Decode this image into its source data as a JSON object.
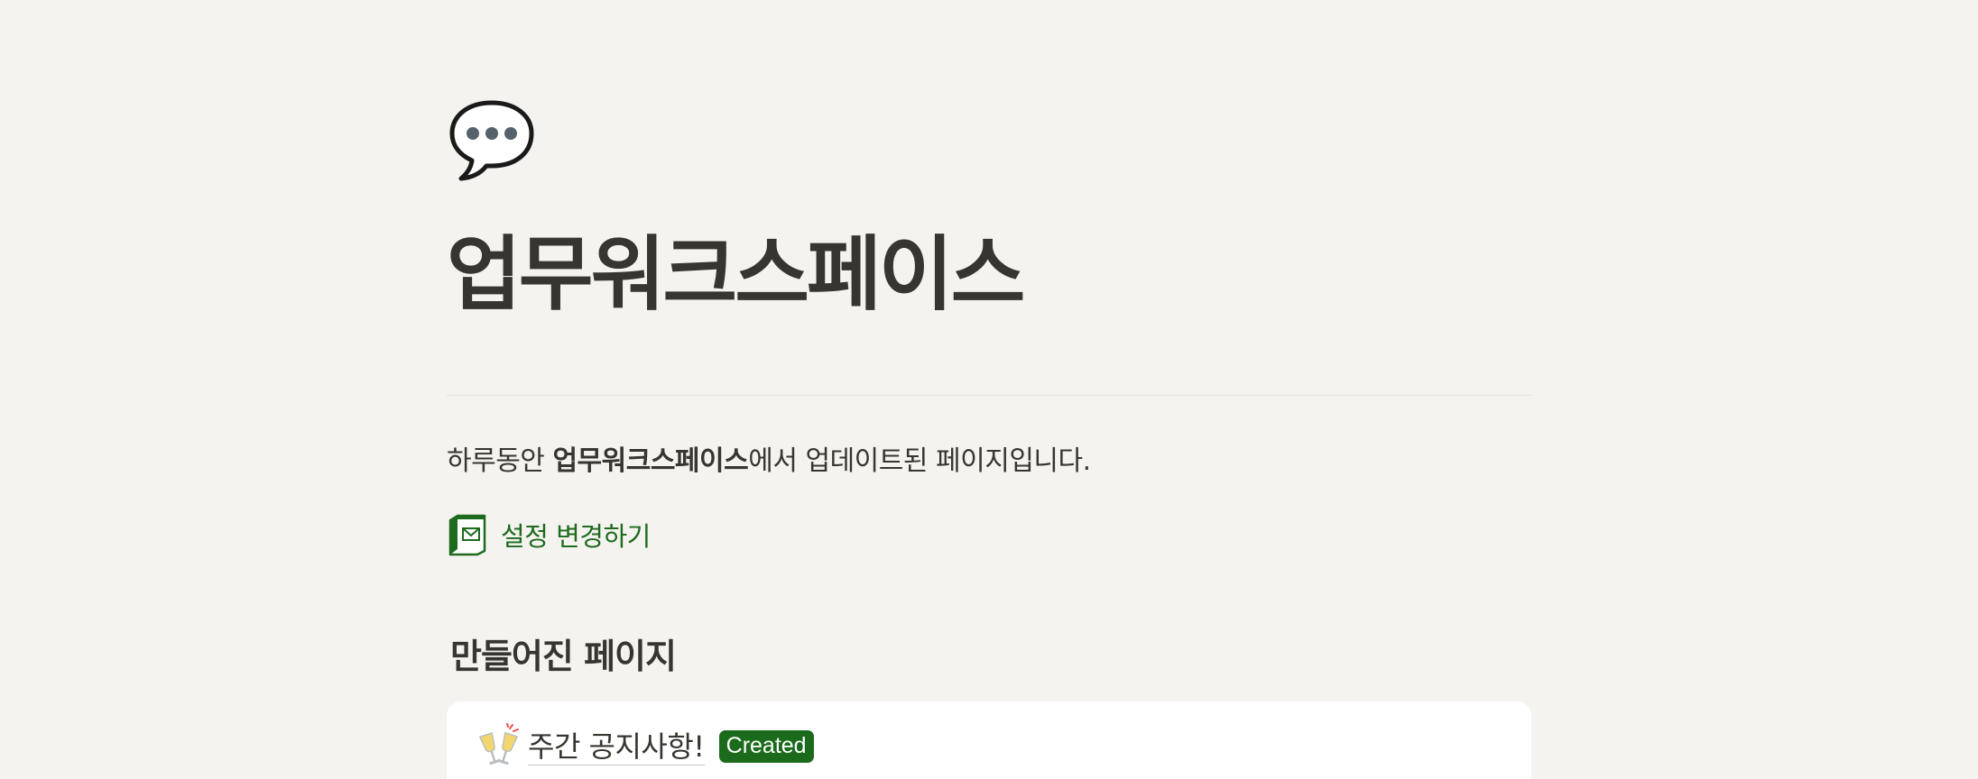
{
  "page": {
    "icon": "speech-bubble-icon",
    "title": "업무워크스페이스"
  },
  "summary": {
    "prefix": "하루동안 ",
    "workspace": "업무워크스페이스",
    "suffix": "에서 업데이트된 페이지입니다."
  },
  "settings": {
    "icon": "notion-mail-icon",
    "label": "설정 변경하기",
    "color": "#1e6b1e"
  },
  "sections": {
    "created": {
      "heading": "만들어진 페이지",
      "items": [
        {
          "icon": "clinking-glasses-icon",
          "title": "주간 공지사항!",
          "status": "Created",
          "status_color": "#1c6b1c"
        }
      ]
    }
  }
}
